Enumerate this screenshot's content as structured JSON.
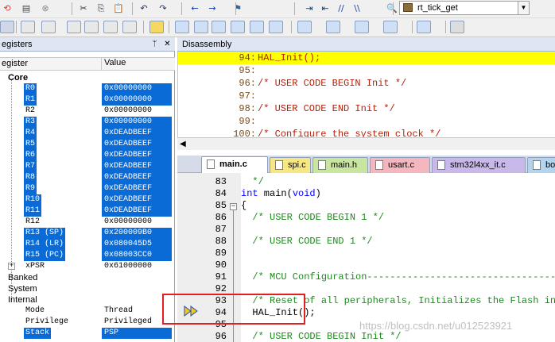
{
  "toolbar": {
    "combo_value": "rt_tick_get",
    "row1_icons": [
      "reset-icon",
      "compile-icon",
      "stop-icon",
      "cut-icon",
      "copy-icon",
      "paste-icon",
      "undo-icon",
      "redo-icon",
      "back-icon",
      "forward-icon",
      "bookmark-icon",
      "indent-icon",
      "outdent-icon",
      "comment-icon",
      "uncomment-icon",
      "find-icon"
    ],
    "row2_icons": [
      "rst-icon",
      "step-icon",
      "stop-debug-icon",
      "step-into-icon",
      "step-over-icon",
      "step-out-icon",
      "run-to-cursor-icon",
      "show-next-icon",
      "command-window-icon",
      "disassembly-window-icon",
      "symbols-window-icon",
      "registers-window-icon",
      "call-stack-icon",
      "watch-window-icon",
      "memory-window-icon",
      "serial-window-icon",
      "analysis-window-icon",
      "trace-window-icon",
      "system-viewer-icon",
      "toolbox-icon"
    ]
  },
  "registers": {
    "title": "egisters",
    "col_register": "egister",
    "col_value": "Value",
    "rows": [
      {
        "name": "Core",
        "value": "",
        "level": 0,
        "selected": false,
        "kind": "core"
      },
      {
        "name": "R0",
        "value": "0x00000000",
        "level": 1,
        "selected": true
      },
      {
        "name": "R1",
        "value": "0x00000000",
        "level": 1,
        "selected": true
      },
      {
        "name": "R2",
        "value": "0x00000000",
        "level": 1,
        "selected": false
      },
      {
        "name": "R3",
        "value": "0x00000000",
        "level": 1,
        "selected": true
      },
      {
        "name": "R4",
        "value": "0xDEADBEEF",
        "level": 1,
        "selected": true
      },
      {
        "name": "R5",
        "value": "0xDEADBEEF",
        "level": 1,
        "selected": true
      },
      {
        "name": "R6",
        "value": "0xDEADBEEF",
        "level": 1,
        "selected": true
      },
      {
        "name": "R7",
        "value": "0xDEADBEEF",
        "level": 1,
        "selected": true
      },
      {
        "name": "R8",
        "value": "0xDEADBEEF",
        "level": 1,
        "selected": true
      },
      {
        "name": "R9",
        "value": "0xDEADBEEF",
        "level": 1,
        "selected": true
      },
      {
        "name": "R10",
        "value": "0xDEADBEEF",
        "level": 1,
        "selected": true
      },
      {
        "name": "R11",
        "value": "0xDEADBEEF",
        "level": 1,
        "selected": true
      },
      {
        "name": "R12",
        "value": "0x00000000",
        "level": 1,
        "selected": false
      },
      {
        "name": "R13 (SP)",
        "value": "0x200009B0",
        "level": 1,
        "selected": true
      },
      {
        "name": "R14 (LR)",
        "value": "0x080045D5",
        "level": 1,
        "selected": true
      },
      {
        "name": "R15 (PC)",
        "value": "0x08003CC0",
        "level": 1,
        "selected": true
      },
      {
        "name": "xPSR",
        "value": "0x61000000",
        "level": 1,
        "selected": false,
        "expander": "+"
      },
      {
        "name": "Banked",
        "value": "",
        "level": 0,
        "selected": false
      },
      {
        "name": "System",
        "value": "",
        "level": 0,
        "selected": false
      },
      {
        "name": "Internal",
        "value": "",
        "level": 0,
        "selected": false
      },
      {
        "name": "Mode",
        "value": "Thread",
        "level": 1,
        "selected": false
      },
      {
        "name": "Privilege",
        "value": "Privileged",
        "level": 1,
        "selected": false
      },
      {
        "name": "Stack",
        "value": "PSP",
        "level": 1,
        "selected": true
      }
    ]
  },
  "disassembly": {
    "title": "Disassembly",
    "lines": [
      {
        "num": "94:",
        "text": "HAL_Init();",
        "highlight": true
      },
      {
        "num": "95:",
        "text": "",
        "highlight": false
      },
      {
        "num": "96:",
        "text": "/* USER CODE BEGIN Init */",
        "highlight": false
      },
      {
        "num": "97:",
        "text": "",
        "highlight": false
      },
      {
        "num": "98:",
        "text": "/* USER CODE END Init */",
        "highlight": false
      },
      {
        "num": "99:",
        "text": "",
        "highlight": false
      },
      {
        "num": "100:",
        "text": "/* Configure the system clock */",
        "highlight": false
      }
    ]
  },
  "tabs": [
    {
      "label": "main.c",
      "active": true,
      "color": "#ffffff"
    },
    {
      "label": "spi.c",
      "active": false,
      "color": "#f7e783"
    },
    {
      "label": "main.h",
      "active": false,
      "color": "#c8e6a0"
    },
    {
      "label": "usart.c",
      "active": false,
      "color": "#f4b6bf"
    },
    {
      "label": "stm32l4xx_it.c",
      "active": false,
      "color": "#c9b9ea"
    },
    {
      "label": "bo",
      "active": false,
      "color": "#b3d3ee"
    }
  ],
  "editor": {
    "lines": [
      {
        "num": "83",
        "parts": [
          {
            "t": "  */",
            "c": "cm"
          }
        ]
      },
      {
        "num": "84",
        "parts": [
          {
            "t": "int",
            "c": "kw"
          },
          {
            "t": " main(",
            "c": ""
          },
          {
            "t": "void",
            "c": "kw"
          },
          {
            "t": ")",
            "c": ""
          }
        ]
      },
      {
        "num": "85",
        "parts": [
          {
            "t": "{",
            "c": ""
          }
        ],
        "fold": "−"
      },
      {
        "num": "86",
        "parts": [
          {
            "t": "  /* USER CODE BEGIN 1 */",
            "c": "cm"
          }
        ]
      },
      {
        "num": "87",
        "parts": []
      },
      {
        "num": "88",
        "parts": [
          {
            "t": "  /* USER CODE END 1 */",
            "c": "cm"
          }
        ]
      },
      {
        "num": "89",
        "parts": []
      },
      {
        "num": "90",
        "parts": []
      },
      {
        "num": "91",
        "parts": [
          {
            "t": "  /* MCU Configuration--------------------------------------------------------*/",
            "c": "cm"
          }
        ]
      },
      {
        "num": "92",
        "parts": []
      },
      {
        "num": "93",
        "parts": [
          {
            "t": "  /* Reset of all peripherals, Initializes the Flash interface and the Systick. */",
            "c": "cm"
          }
        ]
      },
      {
        "num": "94",
        "parts": [
          {
            "t": "  HAL_Init();",
            "c": ""
          }
        ],
        "current": true
      },
      {
        "num": "95",
        "parts": []
      },
      {
        "num": "96",
        "parts": [
          {
            "t": "  /* USER CODE BEGIN Init */",
            "c": "cm"
          }
        ]
      }
    ]
  },
  "watermark": "https://blog.csdn.net/u012523921"
}
